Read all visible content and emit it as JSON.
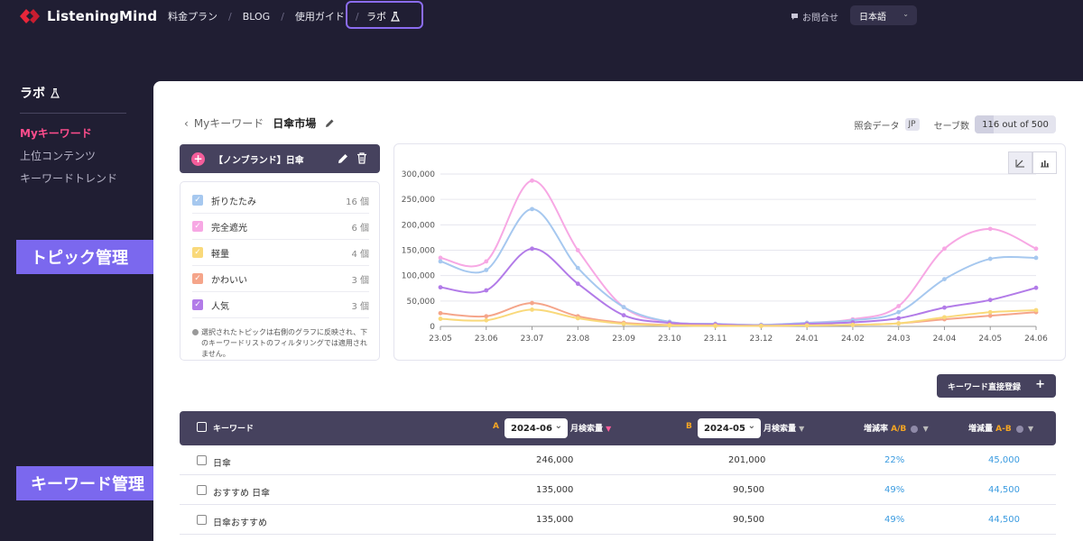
{
  "brand": {
    "name": "ListeningMind"
  },
  "nav": {
    "items": [
      "料金プラン",
      "BLOG",
      "使用ガイド"
    ],
    "separator": "/",
    "lab_label": "ラボ"
  },
  "header_right": {
    "contact": "お問合せ",
    "language": "日本語"
  },
  "sidebar": {
    "title": "ラボ",
    "items": [
      "Myキーワード",
      "上位コンテンツ",
      "キーワードトレンド"
    ],
    "active_index": 0
  },
  "callouts": {
    "topic": "トピック管理",
    "keyword": "キーワード管理"
  },
  "breadcrumb": {
    "back_label": "Myキーワード",
    "title": "日傘市場"
  },
  "meta": {
    "data_label": "照会データ",
    "country": "JP",
    "save_label": "セーブ数",
    "save_value": "116 out of 500",
    "save_fraction": 0.232
  },
  "topic_group": {
    "title": "【ノンブランド】日傘"
  },
  "topics": [
    {
      "name": "折りたたみ",
      "count": "16 個",
      "color": "#a6c8ef"
    },
    {
      "name": "完全遮光",
      "count": "6 個",
      "color": "#f7a8e4"
    },
    {
      "name": "軽量",
      "count": "4 個",
      "color": "#f9d97a"
    },
    {
      "name": "かわいい",
      "count": "3 個",
      "color": "#f5a58a"
    },
    {
      "name": "人気",
      "count": "3 個",
      "color": "#b27be8"
    }
  ],
  "topic_note": "選択されたトピックは右側のグラフに反映され、下のキーワードリストのフィルタリングでは適用されません。",
  "chart_data": {
    "type": "line",
    "x": [
      "23.05",
      "23.06",
      "23.07",
      "23.08",
      "23.09",
      "23.10",
      "23.11",
      "23.12",
      "24.01",
      "24.02",
      "24.03",
      "24.04",
      "24.05",
      "24.06"
    ],
    "yticks": [
      "0",
      "50,000",
      "100,000",
      "150,000",
      "200,000",
      "250,000",
      "300,000"
    ],
    "ylim": [
      0,
      300000
    ],
    "grid": true,
    "series": [
      {
        "color": "#f7a8e4",
        "values": [
          135000,
          128000,
          287000,
          150000,
          38000,
          9000,
          5000,
          3000,
          7000,
          14000,
          40000,
          153000,
          192000,
          153000
        ]
      },
      {
        "color": "#a6c8ef",
        "values": [
          128000,
          111000,
          231000,
          115000,
          38000,
          9000,
          5000,
          3000,
          7000,
          12000,
          28000,
          93000,
          133000,
          135000
        ]
      },
      {
        "color": "#b27be8",
        "values": [
          77000,
          71000,
          153000,
          84000,
          22000,
          7000,
          4000,
          2000,
          5000,
          8000,
          16000,
          37000,
          52000,
          76000
        ]
      },
      {
        "color": "#f5a58a",
        "values": [
          26000,
          20000,
          46000,
          20000,
          7000,
          3000,
          2000,
          1000,
          2000,
          3000,
          6000,
          14000,
          21000,
          28000
        ]
      },
      {
        "color": "#f9d97a",
        "values": [
          15000,
          12000,
          33000,
          16000,
          5000,
          2000,
          1000,
          1000,
          2000,
          3000,
          6000,
          18000,
          28000,
          32000
        ]
      }
    ]
  },
  "add_button": "キーワード直接登録",
  "table": {
    "headers": {
      "keyword": "キーワード",
      "a_tag": "A",
      "a_month": "2024-06",
      "a_label": "月検索量",
      "b_tag": "B",
      "b_month": "2024-05",
      "b_label": "月検索量",
      "rate_label": "増減率",
      "rate_ab": "A/B",
      "diff_label": "増減量",
      "diff_ab": "A-B"
    },
    "rows": [
      {
        "keyword": "日傘",
        "a": "246,000",
        "b": "201,000",
        "rate": "22%",
        "diff": "45,000"
      },
      {
        "keyword": "おすすめ 日傘",
        "a": "135,000",
        "b": "90,500",
        "rate": "49%",
        "diff": "44,500"
      },
      {
        "keyword": "日傘おすすめ",
        "a": "135,000",
        "b": "90,500",
        "rate": "49%",
        "diff": "44,500"
      }
    ]
  }
}
